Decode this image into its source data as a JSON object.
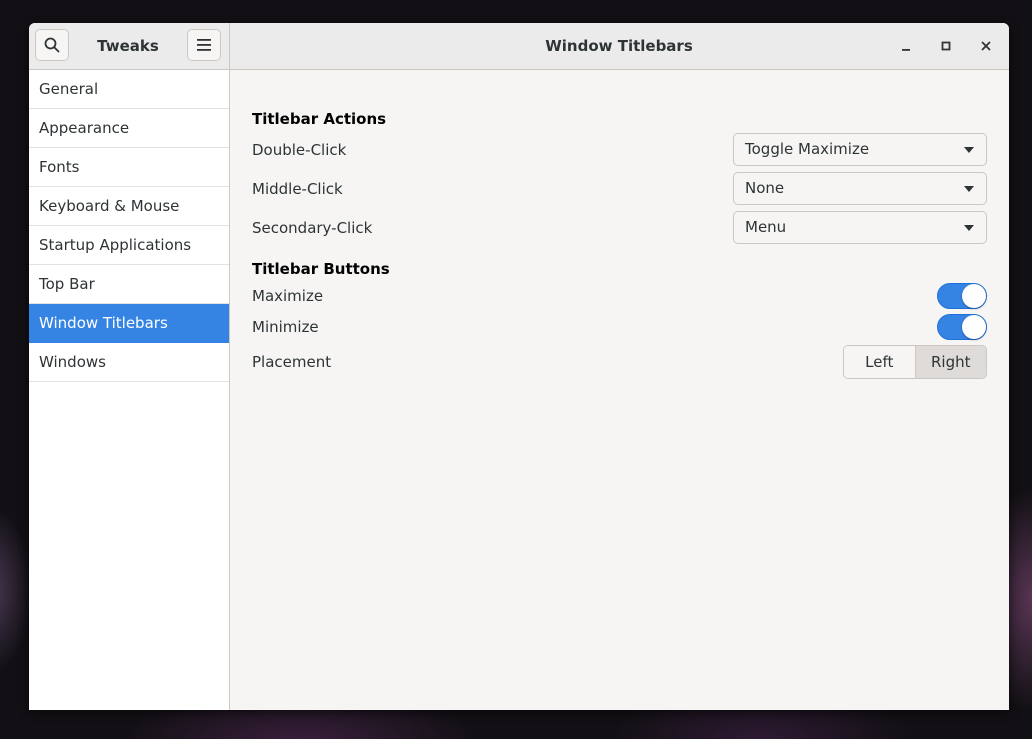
{
  "window": {
    "sidebar_title": "Tweaks",
    "title": "Window Titlebars",
    "search_icon": "search-icon",
    "menu_icon": "hamburger-menu-icon",
    "minimize_icon": "minimize-icon",
    "maximize_icon": "maximize-icon",
    "close_icon": "close-icon"
  },
  "sidebar": {
    "items": [
      {
        "label": "General",
        "selected": false
      },
      {
        "label": "Appearance",
        "selected": false
      },
      {
        "label": "Fonts",
        "selected": false
      },
      {
        "label": "Keyboard & Mouse",
        "selected": false
      },
      {
        "label": "Startup Applications",
        "selected": false
      },
      {
        "label": "Top Bar",
        "selected": false
      },
      {
        "label": "Window Titlebars",
        "selected": true
      },
      {
        "label": "Windows",
        "selected": false
      }
    ]
  },
  "titlebar_actions": {
    "heading": "Titlebar Actions",
    "double_click": {
      "label": "Double-Click",
      "value": "Toggle Maximize"
    },
    "middle_click": {
      "label": "Middle-Click",
      "value": "None"
    },
    "secondary_click": {
      "label": "Secondary-Click",
      "value": "Menu"
    }
  },
  "titlebar_buttons": {
    "heading": "Titlebar Buttons",
    "maximize": {
      "label": "Maximize",
      "enabled": true
    },
    "minimize": {
      "label": "Minimize",
      "enabled": true
    },
    "placement": {
      "label": "Placement",
      "options": [
        "Left",
        "Right"
      ],
      "selected": "Right"
    }
  },
  "colors": {
    "accent": "#3584e4",
    "background": "#f6f5f4",
    "headerbar": "#ebebeb"
  }
}
